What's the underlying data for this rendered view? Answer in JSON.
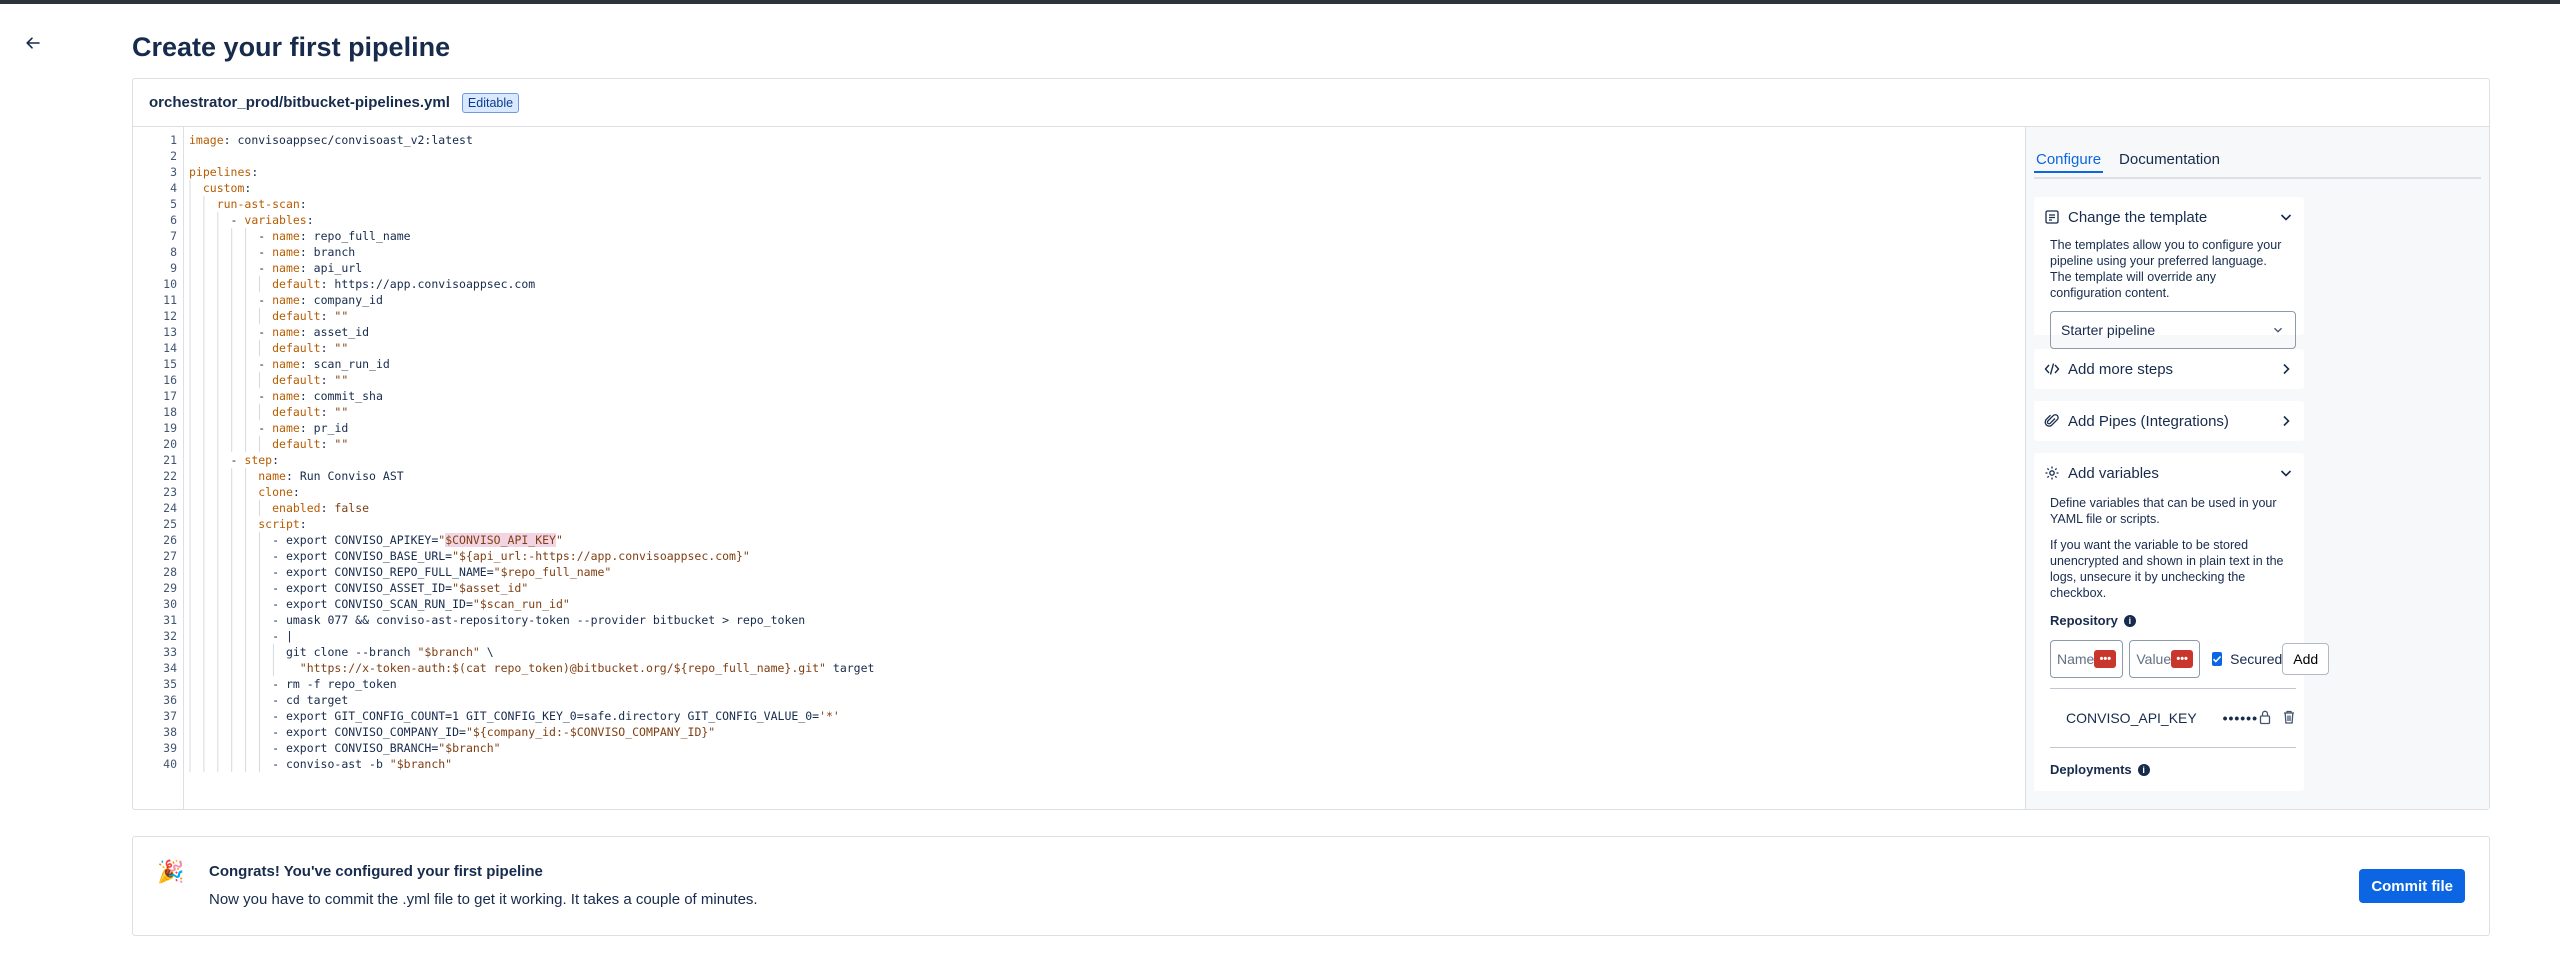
{
  "page": {
    "title": "Create your first pipeline"
  },
  "editor": {
    "file_name": "orchestrator_prod/bitbucket-pipelines.yml",
    "badge": "Editable",
    "lines": [
      {
        "n": "1",
        "i": 0,
        "k": "image",
        "v": " convisoappsec/convisoast_v2:latest"
      },
      {
        "n": "2",
        "i": 0,
        "k": "",
        "v": ""
      },
      {
        "n": "3",
        "i": 0,
        "k": "pipelines",
        "v": ""
      },
      {
        "n": "4",
        "i": 1,
        "k": "custom",
        "v": ""
      },
      {
        "n": "5",
        "i": 2,
        "k": "run-ast-scan",
        "v": ""
      },
      {
        "n": "6",
        "i": 3,
        "p": "- ",
        "k": "variables",
        "v": ""
      },
      {
        "n": "7",
        "i": 5,
        "p": "- ",
        "k": "name",
        "v": " repo_full_name"
      },
      {
        "n": "8",
        "i": 5,
        "p": "- ",
        "k": "name",
        "v": " branch"
      },
      {
        "n": "9",
        "i": 5,
        "p": "- ",
        "k": "name",
        "v": " api_url"
      },
      {
        "n": "10",
        "i": 6,
        "k": "default",
        "v": " https://app.convisoappsec.com"
      },
      {
        "n": "11",
        "i": 5,
        "p": "- ",
        "k": "name",
        "v": " company_id"
      },
      {
        "n": "12",
        "i": 6,
        "k": "default",
        "s": " \"\""
      },
      {
        "n": "13",
        "i": 5,
        "p": "- ",
        "k": "name",
        "v": " asset_id"
      },
      {
        "n": "14",
        "i": 6,
        "k": "default",
        "s": " \"\""
      },
      {
        "n": "15",
        "i": 5,
        "p": "- ",
        "k": "name",
        "v": " scan_run_id"
      },
      {
        "n": "16",
        "i": 6,
        "k": "default",
        "s": " \"\""
      },
      {
        "n": "17",
        "i": 5,
        "p": "- ",
        "k": "name",
        "v": " commit_sha"
      },
      {
        "n": "18",
        "i": 6,
        "k": "default",
        "s": " \"\""
      },
      {
        "n": "19",
        "i": 5,
        "p": "- ",
        "k": "name",
        "v": " pr_id"
      },
      {
        "n": "20",
        "i": 6,
        "k": "default",
        "s": " \"\""
      },
      {
        "n": "21",
        "i": 3,
        "p": "- ",
        "k": "step",
        "v": ""
      },
      {
        "n": "22",
        "i": 5,
        "k": "name",
        "v": " Run Conviso AST"
      },
      {
        "n": "23",
        "i": 5,
        "k": "clone",
        "v": ""
      },
      {
        "n": "24",
        "i": 6,
        "k": "enabled",
        "s": " false"
      },
      {
        "n": "25",
        "i": 5,
        "k": "script",
        "v": ""
      },
      {
        "n": "26",
        "i": 6,
        "t": "- export CONVISO_APIKEY=",
        "s": "\"",
        "h": "$CONVISO_API_KEY",
        "s2": "\""
      },
      {
        "n": "27",
        "i": 6,
        "t": "- export CONVISO_BASE_URL=",
        "s": "\"${api_url:-https://app.convisoappsec.com}\""
      },
      {
        "n": "28",
        "i": 6,
        "t": "- export CONVISO_REPO_FULL_NAME=",
        "s": "\"$repo_full_name\""
      },
      {
        "n": "29",
        "i": 6,
        "t": "- export CONVISO_ASSET_ID=",
        "s": "\"$asset_id\""
      },
      {
        "n": "30",
        "i": 6,
        "t": "- export CONVISO_SCAN_RUN_ID=",
        "s": "\"$scan_run_id\""
      },
      {
        "n": "31",
        "i": 6,
        "t": "- umask 077 && conviso-ast-repository-token --provider bitbucket > repo_token"
      },
      {
        "n": "32",
        "i": 6,
        "t": "- |"
      },
      {
        "n": "33",
        "i": 7,
        "t": "git clone --branch ",
        "s": "\"$branch\"",
        "t2": " \\"
      },
      {
        "n": "34",
        "i": 8,
        "s": "\"https://x-token-auth:$(cat repo_token)@bitbucket.org/${repo_full_name}.git\"",
        "t2": " target"
      },
      {
        "n": "35",
        "i": 6,
        "t": "- rm -f repo_token"
      },
      {
        "n": "36",
        "i": 6,
        "t": "- cd target"
      },
      {
        "n": "37",
        "i": 6,
        "t": "- export GIT_CONFIG_COUNT=1 GIT_CONFIG_KEY_0=safe.directory GIT_CONFIG_VALUE_0=",
        "s": "'*'"
      },
      {
        "n": "38",
        "i": 6,
        "t": "- export CONVISO_COMPANY_ID=",
        "s": "\"${company_id:-$CONVISO_COMPANY_ID}\""
      },
      {
        "n": "39",
        "i": 6,
        "t": "- export CONVISO_BRANCH=",
        "s": "\"$branch\""
      },
      {
        "n": "40",
        "i": 6,
        "t": "- conviso-ast -b ",
        "s": "\"$branch\""
      }
    ]
  },
  "side": {
    "tabs": [
      {
        "label": "Configure",
        "active": true
      },
      {
        "label": "Documentation",
        "active": false
      }
    ],
    "template": {
      "title": "Change the template",
      "desc": "The templates allow you to configure your pipeline using your preferred language. The template will override any configuration content.",
      "selected": "Starter pipeline"
    },
    "steps": {
      "title": "Add more steps"
    },
    "pipes": {
      "title": "Add Pipes (Integrations)"
    },
    "variables": {
      "title": "Add variables",
      "desc1": "Define variables that can be used in your YAML file or scripts.",
      "desc2": "If you want the variable to be stored unencrypted and shown in plain text in the logs, unsecure it by unchecking the checkbox.",
      "repository_label": "Repository",
      "name_placeholder": "Name",
      "value_placeholder": "Value",
      "secured_label": "Secured",
      "add_label": "Add",
      "items": [
        {
          "name": "CONVISO_API_KEY",
          "value": "••••••"
        }
      ],
      "deployments_label": "Deployments"
    }
  },
  "congrats": {
    "emoji": "🎉",
    "title": "Congrats! You've configured your first pipeline",
    "desc": "Now you have to commit the .yml file to get it working. It takes a couple of minutes.",
    "button": "Commit file"
  }
}
